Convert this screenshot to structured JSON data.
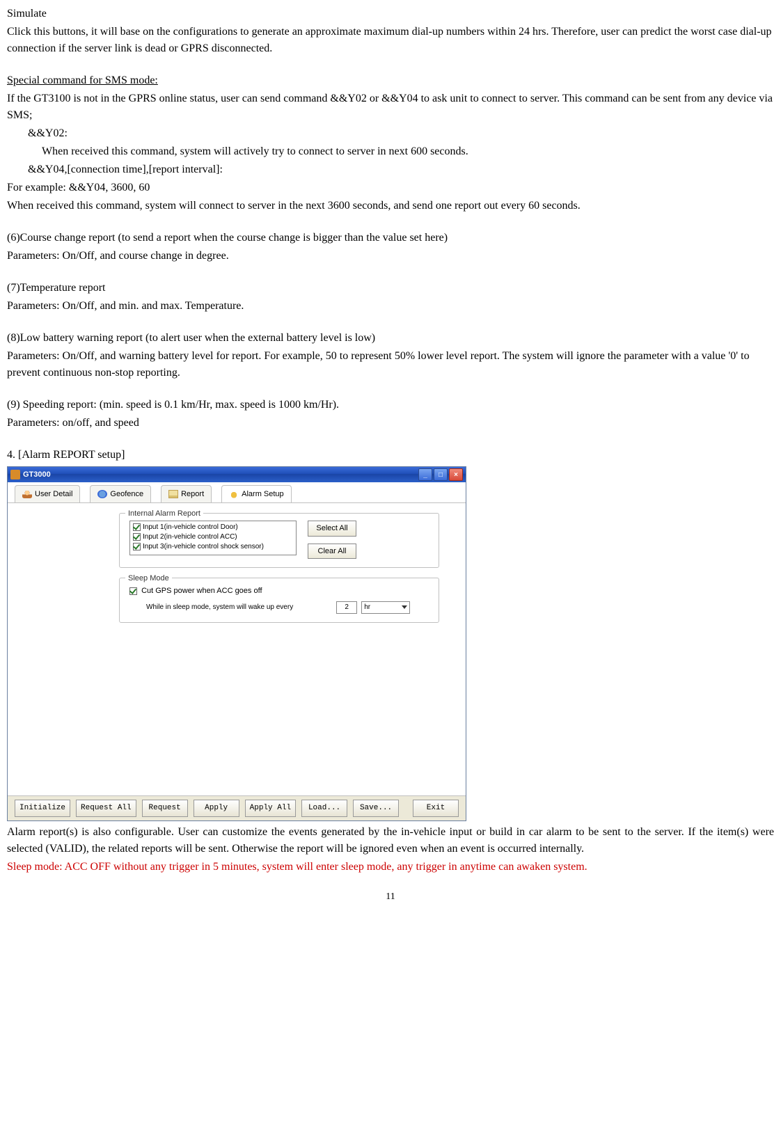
{
  "heading_simulate": "Simulate",
  "para_simulate": "Click this buttons, it will base on the configurations to generate an approximate maximum dial-up numbers within 24 hrs. Therefore, user can predict the worst case dial-up connection if the server link is dead or GPRS disconnected.",
  "heading_sms": "Special command for SMS mode:",
  "sms_intro": "If the GT3100 is not in the GPRS online status, user can send command &&Y02 or &&Y04 to ask unit to connect to server. This command can be sent from any device via SMS;",
  "cmd_y02": "&&Y02:",
  "cmd_y02_desc": "When received this command, system will actively try to connect to server in next 600 seconds.",
  "cmd_y04": "&&Y04,[connection time],[report interval]:",
  "cmd_y04_example": "For example: &&Y04, 3600, 60",
  "cmd_y04_desc": "When received this command, system will connect to server in the next 3600 seconds, and send one report out every 60 seconds.",
  "sec6_title": "(6)Course change report (to send a report when the course change is bigger than the value set here)",
  "sec6_params": "Parameters: On/Off, and course change in degree.",
  "sec7_title": "(7)Temperature report",
  "sec7_params": "Parameters: On/Off, and min. and max. Temperature.",
  "sec8_title": "(8)Low battery warning report (to alert user when the external battery level is low)",
  "sec8_params": "Parameters: On/Off, and warning battery level for report. For example, 50 to represent 50% lower level report. The system will ignore the parameter with a value '0' to prevent continuous non-stop reporting.",
  "sec9_title": "(9) Speeding report: (min. speed is 0.1 km/Hr, max. speed is 1000 km/Hr).",
  "sec9_params": "Parameters: on/off, and speed",
  "sec4_heading": "4. [Alarm REPORT setup]",
  "app": {
    "title": "GT3000",
    "tabs": {
      "user_detail": "User Detail",
      "geofence": "Geofence",
      "report": "Report",
      "alarm_setup": "Alarm Setup"
    },
    "fieldset_alarm": "Internal Alarm Report",
    "alarm_items": [
      "Input 1(in-vehicle control Door)",
      "Input 2(in-vehicle control ACC)",
      "Input 3(in-vehicle control shock sensor)"
    ],
    "btn_select_all": "Select All",
    "btn_clear_all": "Clear All",
    "fieldset_sleep": "Sleep Mode",
    "sleep_check": "Cut GPS power when ACC goes off",
    "sleep_label": "While in sleep mode, system will wake up every",
    "sleep_value": "2",
    "sleep_unit": "hr",
    "toolbar": {
      "initialize": "Initialize",
      "request_all": "Request All",
      "request": "Request",
      "apply": "Apply",
      "apply_all": "Apply All",
      "load": "Load...",
      "save": "Save...",
      "exit": "Exit"
    }
  },
  "para_alarm_desc": "Alarm report(s) is also configurable. User can customize the events generated by the in-vehicle input or build in car alarm to be sent to the server. If the item(s) were selected (VALID), the related reports will be sent. Otherwise the report will be ignored even when an event is occurred internally.",
  "para_sleep_red": "Sleep mode: ACC OFF without any trigger in 5 minutes, system will enter sleep mode, any trigger in anytime can awaken system.",
  "page_number": "11"
}
